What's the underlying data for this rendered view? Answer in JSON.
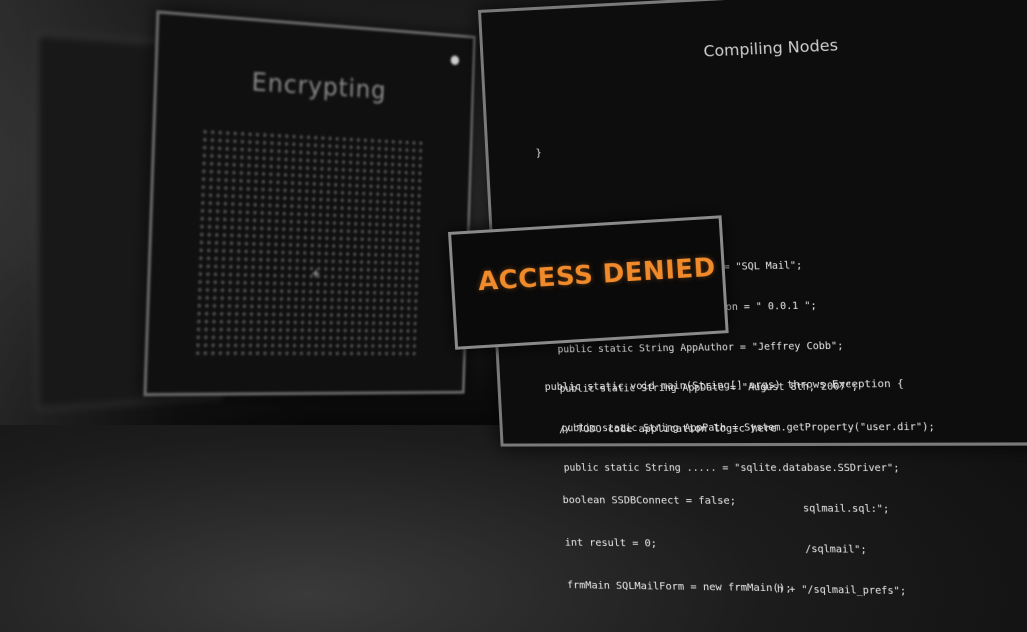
{
  "encrypting_window": {
    "title": "Encrypting",
    "cursor": "+"
  },
  "compiling_window": {
    "title": "Compiling Nodes",
    "close": "x",
    "code_lines": [
      "  }",
      "  ",
      "  ",
      "    public static String AppName = \"SQL Mail\";",
      "    public static String AppVersion = \" 0.0.1 \";",
      "    public static String AppAuthor = \"Jeffrey Cobb\";",
      "    public static String AppDate = \"August 8th, 2007\";",
      "    public static String AppPath = System.getProperty(\"user.dir\");",
      "    public static String ..... = \"sqlite.database.SSDriver\";",
      "                                            sqlmail.sql:\";",
      "                                            /sqlmail\";",
      "                                       h + \"/sqlmail_prefs\";"
    ],
    "code_bottom": [
      "    public static void main(String[] args) throws Exception {",
      "      // TODO code application logic here",
      "",
      "      boolean SSDBConnect = false;",
      "      int result = 0;",
      "      frmMain SQLMailForm = new frmMain();"
    ]
  },
  "alert": {
    "text": "ACCESS DENIED"
  },
  "colors": {
    "alert_text": "#f08a2a",
    "window_border": "#7a7a7a",
    "background": "#151515"
  }
}
